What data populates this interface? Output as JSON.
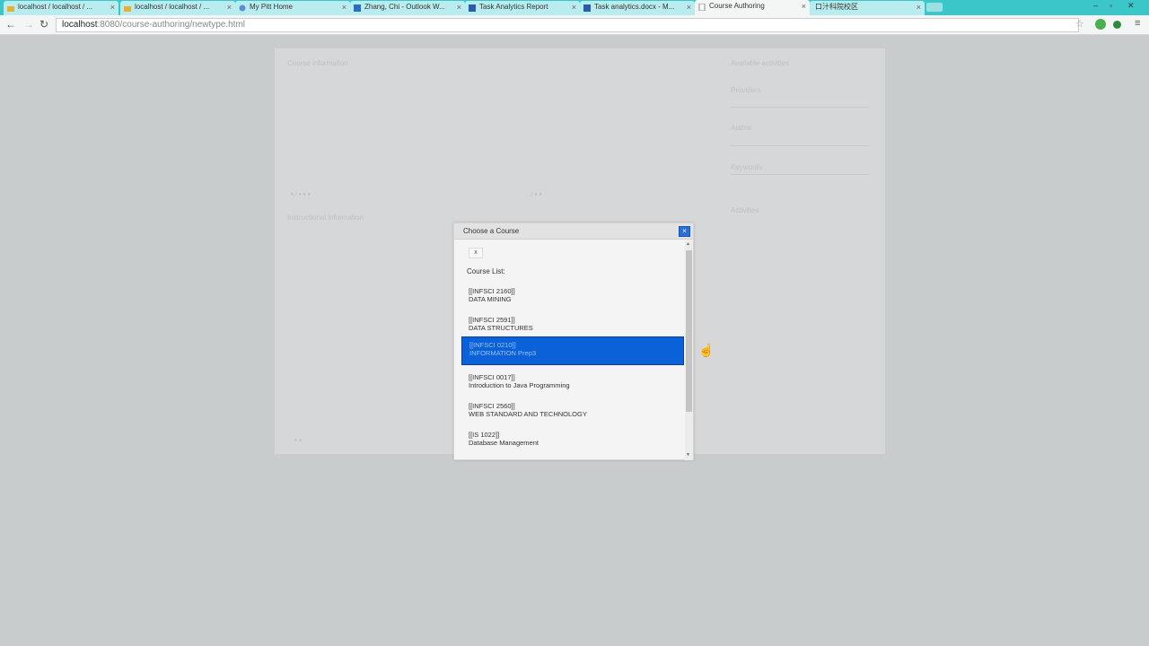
{
  "browser": {
    "tabs": [
      {
        "label": "localhost / localhost / ..."
      },
      {
        "label": "localhost / localhost / ..."
      },
      {
        "label": "My Pitt Home"
      },
      {
        "label": "Zhang, Chi - Outlook W..."
      },
      {
        "label": "Task Analytics Report"
      },
      {
        "label": "Task analytics.docx - M..."
      },
      {
        "label": "Course Authoring"
      },
      {
        "label": "口汁科院校区"
      }
    ],
    "address": {
      "host": "localhost",
      "path": ":8080/course-authoring/newtype.html"
    }
  },
  "background_form": {
    "course_information_label": "Course information",
    "available_activities_label": "Available activities",
    "providers_label": "Providers",
    "author_label": "Author",
    "keywords_label": "Keywords",
    "activities_label": "Activities",
    "instructional_label": "Instructional information"
  },
  "dialog": {
    "title": "Choose a Course",
    "close_glyph": "×",
    "mini_button": "x",
    "list_label": "Course List:",
    "courses": [
      {
        "code": "[[INFSCI 2160]]",
        "name": "DATA MINING"
      },
      {
        "code": "[[INFSCI 2591]]",
        "name": "DATA STRUCTURES"
      },
      {
        "code": "[[INFSCI 0210]]",
        "name": "INFORMATION Prep3"
      },
      {
        "code": "[[INFSCI 0017]]",
        "name": "Introduction to Java Programming"
      },
      {
        "code": "[[INFSCI 2560]]",
        "name": "WEB STANDARD AND TECHNOLOGY"
      },
      {
        "code": "[[IS 1022]]",
        "name": "Database Management"
      }
    ],
    "selected_index": 2
  },
  "colors": {
    "tabstrip": "#3bc7c9",
    "selection": "#0a61d8",
    "close_button": "#2d6fd6"
  }
}
